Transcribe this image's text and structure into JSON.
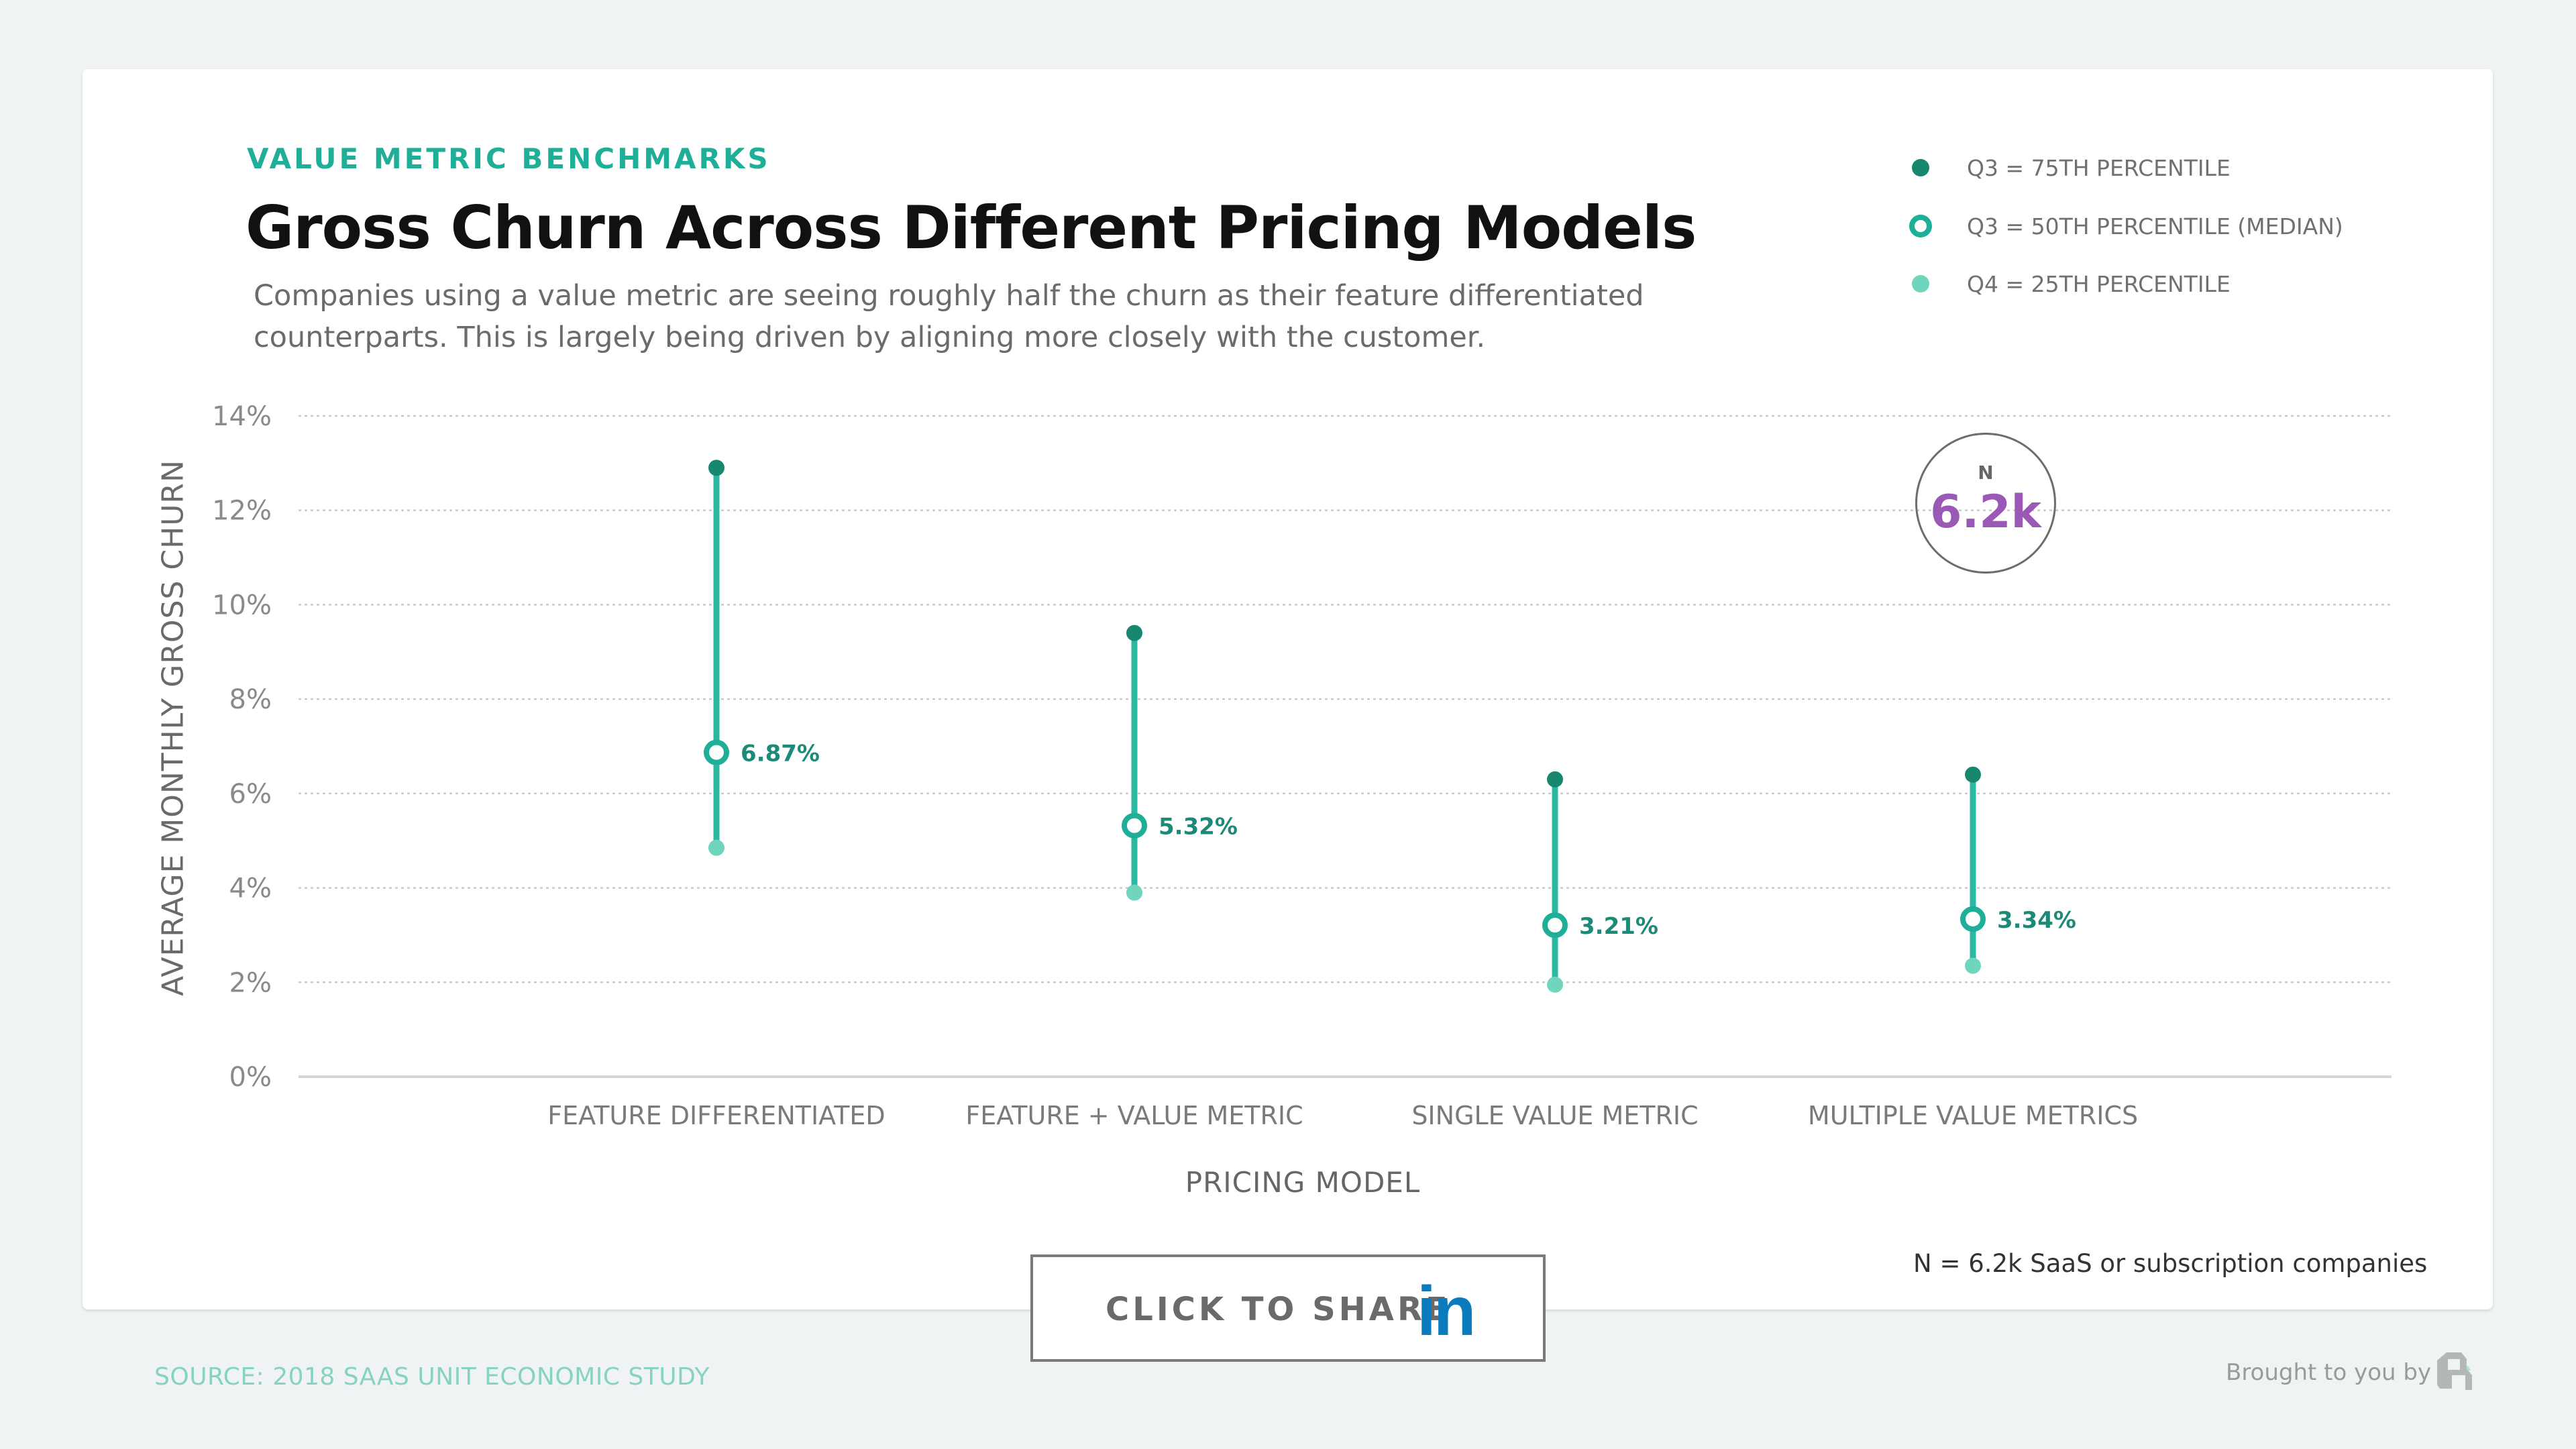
{
  "header": {
    "kicker": "VALUE METRIC BENCHMARKS",
    "title": "Gross Churn Across Different Pricing Models",
    "subtitle": "Companies using a value metric are seeing roughly half the churn as their feature differentiated counterparts. This is largely being driven by aligning more closely with the customer."
  },
  "legend": [
    {
      "label": "Q3 = 75TH PERCENTILE",
      "style": "filled",
      "color": "#17876f"
    },
    {
      "label": "Q3 = 50TH PERCENTILE (MEDIAN)",
      "style": "ring",
      "color": "#1fae98"
    },
    {
      "label": "Q4 = 25TH PERCENTILE",
      "style": "filled",
      "color": "#6fd6bd"
    }
  ],
  "n_badge": {
    "label": "N",
    "value": "6.2k"
  },
  "n_note": "N = 6.2k SaaS or subscription companies",
  "share_button": {
    "label": "CLICK TO SHARE",
    "icon": "linkedin-icon",
    "icon_text": "in"
  },
  "footer": {
    "source": "SOURCE: 2018 SAAS UNIT ECONOMIC STUDY",
    "brought_by": "Brought to you by",
    "logo": "profitwell-logo-icon"
  },
  "colors": {
    "q75": "#17876f",
    "median": "#1fae98",
    "q25": "#6fd6bd",
    "line": "#2bb8a2",
    "accent_purple": "#9b59b6"
  },
  "chart_data": {
    "type": "range-dot",
    "title": "Gross Churn Across Different Pricing Models",
    "xlabel": "PRICING MODEL",
    "ylabel": "AVERAGE MONTHLY GROSS CHURN",
    "ylim": [
      0,
      14
    ],
    "yticks": [
      0,
      2,
      4,
      6,
      8,
      10,
      12,
      14
    ],
    "ytick_labels": [
      "0%",
      "2%",
      "4%",
      "6%",
      "8%",
      "10%",
      "12%",
      "14%"
    ],
    "grid": true,
    "legend_position": "top-right",
    "categories": [
      "FEATURE DIFFERENTIATED",
      "FEATURE + VALUE METRIC",
      "SINGLE VALUE METRIC",
      "MULTIPLE VALUE METRICS"
    ],
    "series": [
      {
        "name": "Q3 = 75TH PERCENTILE",
        "values": [
          12.9,
          9.4,
          6.3,
          6.4
        ]
      },
      {
        "name": "Q3 = 50TH PERCENTILE (MEDIAN)",
        "values": [
          6.87,
          5.32,
          3.21,
          3.34
        ]
      },
      {
        "name": "Q4 = 25TH PERCENTILE",
        "values": [
          4.85,
          3.9,
          1.95,
          2.35
        ]
      }
    ],
    "median_labels": [
      "6.87%",
      "5.32%",
      "3.21%",
      "3.34%"
    ]
  }
}
